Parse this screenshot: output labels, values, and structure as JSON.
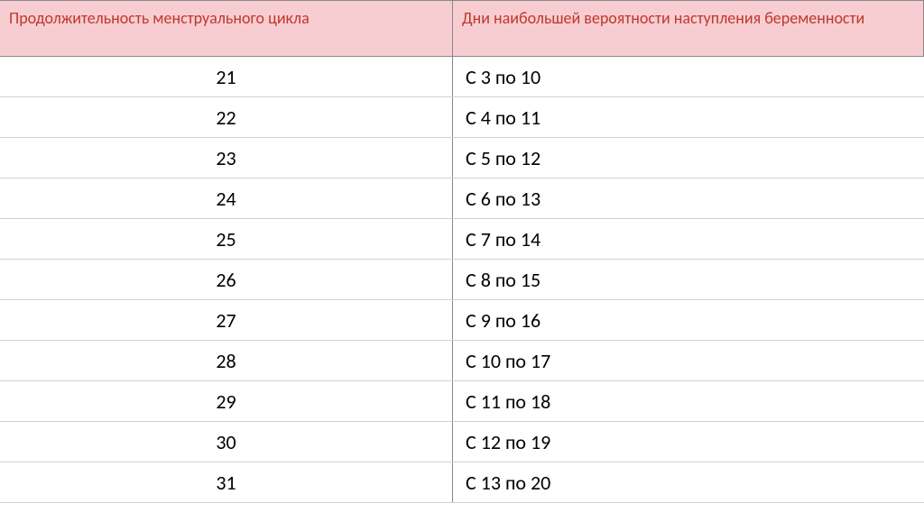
{
  "headers": {
    "col1": "Продолжительность менструального цикла",
    "col2": "Дни наибольшей вероятности наступления беременности"
  },
  "rows": [
    {
      "length": "21",
      "days": "С 3  по 10"
    },
    {
      "length": "22",
      "days": "С 4 по 11"
    },
    {
      "length": "23",
      "days": "С 5 по 12"
    },
    {
      "length": "24",
      "days": "С 6 по 13"
    },
    {
      "length": "25",
      "days": "С 7 по 14"
    },
    {
      "length": "26",
      "days": "С 8 по 15"
    },
    {
      "length": "27",
      "days": "С 9 по 16"
    },
    {
      "length": "28",
      "days": "С 10 по 17"
    },
    {
      "length": "29",
      "days": "С 11 по 18"
    },
    {
      "length": "30",
      "days": "С 12 по 19"
    },
    {
      "length": "31",
      "days": "С 13 по 20"
    }
  ]
}
